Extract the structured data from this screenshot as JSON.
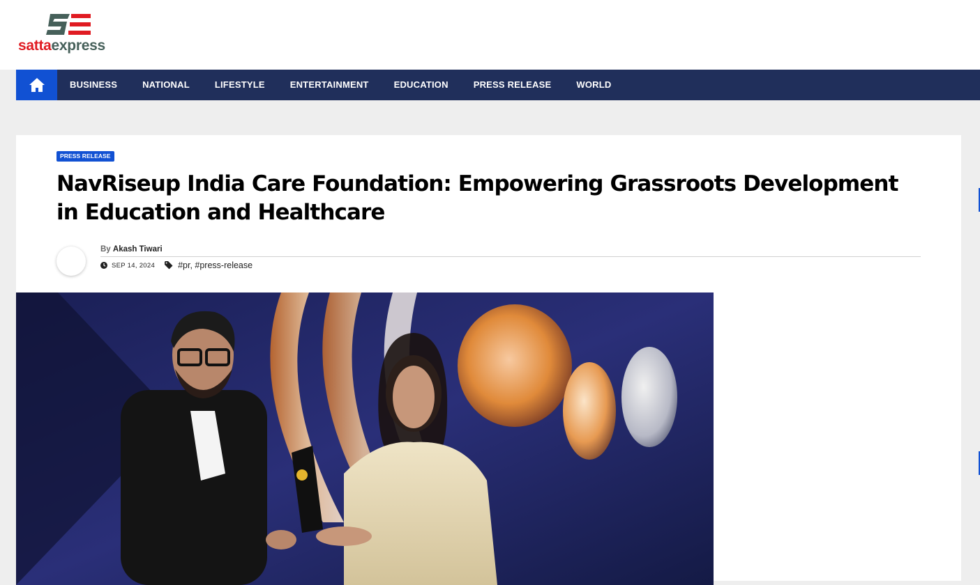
{
  "site": {
    "logo_part1": "satta",
    "logo_part2": "express",
    "logo_icon": "se-logo-mark",
    "brand_colors": {
      "red": "#e01b22",
      "slate": "#46605a"
    }
  },
  "nav": {
    "home_icon": "home-icon",
    "items": [
      {
        "label": "BUSINESS"
      },
      {
        "label": "NATIONAL"
      },
      {
        "label": "LIFESTYLE"
      },
      {
        "label": "ENTERTAINMENT"
      },
      {
        "label": "EDUCATION"
      },
      {
        "label": "PRESS RELEASE"
      },
      {
        "label": "WORLD"
      }
    ],
    "colors": {
      "bar": "#202f5b",
      "home": "#1151d3"
    }
  },
  "article": {
    "category": "PRESS RELEASE",
    "title": "NavRiseup India Care Foundation: Empowering Grassroots Development in Education and Healthcare",
    "by_label": "By",
    "author": "Akash Tiwari",
    "date": "SEP 14, 2024",
    "tag1": "#pr",
    "tag_sep": ", ",
    "tag2": "#press-release",
    "clock_icon": "clock-icon",
    "tag_icon": "tag-icon",
    "hero_image": "award-ceremony-photo"
  }
}
